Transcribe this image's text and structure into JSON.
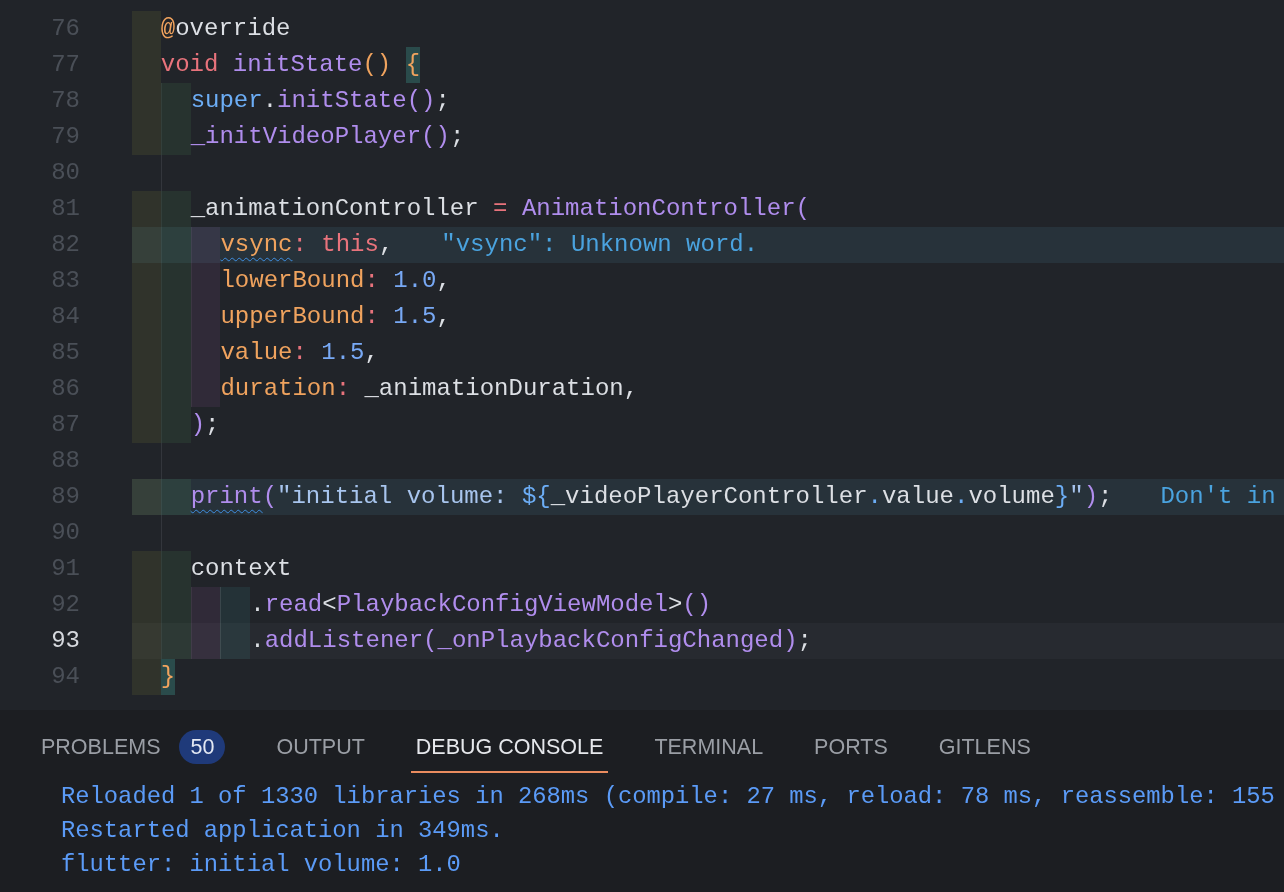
{
  "editor": {
    "lines": [
      {
        "number": "76",
        "current": false,
        "tokens": [
          {
            "text": "  @",
            "kind": "annotation"
          },
          {
            "text": "override",
            "kind": "plain"
          }
        ]
      },
      {
        "number": "77",
        "current": false,
        "tokens": [
          {
            "text": "  void ",
            "kind": "keyword"
          },
          {
            "text": "initState",
            "kind": "function"
          },
          {
            "text": "() ",
            "kind": "bracket"
          },
          {
            "text": "{",
            "kind": "matched-bracket"
          }
        ]
      },
      {
        "number": "78",
        "current": false,
        "tokens": [
          {
            "text": "    super",
            "kind": "builtin"
          },
          {
            "text": ".",
            "kind": "plain"
          },
          {
            "text": "initState",
            "kind": "function"
          },
          {
            "text": "()",
            "kind": "paren"
          },
          {
            "text": ";",
            "kind": "plain"
          }
        ]
      },
      {
        "number": "79",
        "current": false,
        "tokens": [
          {
            "text": "    _initVideoPlayer",
            "kind": "function"
          },
          {
            "text": "()",
            "kind": "paren"
          },
          {
            "text": ";",
            "kind": "plain"
          }
        ]
      },
      {
        "number": "80",
        "current": false
      },
      {
        "number": "81",
        "current": false,
        "tokens": [
          {
            "text": "    _animationController ",
            "kind": "plain"
          },
          {
            "text": "= ",
            "kind": "operator"
          },
          {
            "text": "AnimationController",
            "kind": "function"
          },
          {
            "text": "(",
            "kind": "paren"
          }
        ]
      },
      {
        "number": "82",
        "current": false,
        "diagnostic": "\"vsync\": Unknown word.",
        "tokens": [
          {
            "text": "      vsync",
            "kind": "property"
          },
          {
            "text": ": ",
            "kind": "operator"
          },
          {
            "text": "this",
            "kind": "keyword"
          },
          {
            "text": ",",
            "kind": "plain"
          }
        ]
      },
      {
        "number": "83",
        "current": false,
        "tokens": [
          {
            "text": "      lowerBound",
            "kind": "property"
          },
          {
            "text": ": ",
            "kind": "operator"
          },
          {
            "text": "1.0",
            "kind": "number"
          },
          {
            "text": ",",
            "kind": "plain"
          }
        ]
      },
      {
        "number": "84",
        "current": false,
        "tokens": [
          {
            "text": "      upperBound",
            "kind": "property"
          },
          {
            "text": ": ",
            "kind": "operator"
          },
          {
            "text": "1.5",
            "kind": "number"
          },
          {
            "text": ",",
            "kind": "plain"
          }
        ]
      },
      {
        "number": "85",
        "current": false,
        "tokens": [
          {
            "text": "      value",
            "kind": "property"
          },
          {
            "text": ": ",
            "kind": "operator"
          },
          {
            "text": "1.5",
            "kind": "number"
          },
          {
            "text": ",",
            "kind": "plain"
          }
        ]
      },
      {
        "number": "86",
        "current": false,
        "tokens": [
          {
            "text": "      duration",
            "kind": "property"
          },
          {
            "text": ": ",
            "kind": "operator"
          },
          {
            "text": "_animationDuration,",
            "kind": "plain"
          }
        ]
      },
      {
        "number": "87",
        "current": false,
        "tokens": [
          {
            "text": "    )",
            "kind": "paren"
          },
          {
            "text": ";",
            "kind": "plain"
          }
        ]
      },
      {
        "number": "88",
        "current": false
      },
      {
        "number": "89",
        "current": false,
        "diagnostic": "Don't in",
        "tokens": [
          {
            "text": "    print",
            "kind": "function"
          },
          {
            "text": "(",
            "kind": "paren"
          },
          {
            "text": "\"initial volume: ",
            "kind": "string"
          },
          {
            "text": "${",
            "kind": "interpolation"
          },
          {
            "text": "_videoPlayerController",
            "kind": "plain"
          },
          {
            "text": ".",
            "kind": "interpolation"
          },
          {
            "text": "value",
            "kind": "plain"
          },
          {
            "text": ".",
            "kind": "interpolation"
          },
          {
            "text": "volume",
            "kind": "plain"
          },
          {
            "text": "}",
            "kind": "interpolation"
          },
          {
            "text": "\"",
            "kind": "string"
          },
          {
            "text": ")",
            "kind": "paren"
          },
          {
            "text": ";",
            "kind": "plain"
          }
        ]
      },
      {
        "number": "90",
        "current": false
      },
      {
        "number": "91",
        "current": false,
        "tokens": [
          {
            "text": "    context",
            "kind": "plain"
          }
        ]
      },
      {
        "number": "92",
        "current": false,
        "tokens": [
          {
            "text": "        .",
            "kind": "plain"
          },
          {
            "text": "read",
            "kind": "function"
          },
          {
            "text": "<",
            "kind": "plain"
          },
          {
            "text": "PlaybackConfigViewModel",
            "kind": "function"
          },
          {
            "text": ">",
            "kind": "plain"
          },
          {
            "text": "()",
            "kind": "paren"
          }
        ]
      },
      {
        "number": "93",
        "current": true,
        "tokens": [
          {
            "text": "        .",
            "kind": "plain"
          },
          {
            "text": "addListener",
            "kind": "function"
          },
          {
            "text": "(",
            "kind": "paren"
          },
          {
            "text": "_onPlaybackConfigChanged",
            "kind": "function"
          },
          {
            "text": ")",
            "kind": "paren"
          },
          {
            "text": ";",
            "kind": "plain"
          }
        ]
      },
      {
        "number": "94",
        "current": false,
        "tokens": [
          {
            "text": "  }",
            "kind": "matched-bracket"
          }
        ]
      }
    ]
  },
  "panel": {
    "tabs": [
      {
        "label": "PROBLEMS",
        "selected": false,
        "badge": "50"
      },
      {
        "label": "OUTPUT",
        "selected": false
      },
      {
        "label": "DEBUG CONSOLE",
        "selected": true
      },
      {
        "label": "TERMINAL",
        "selected": false
      },
      {
        "label": "PORTS",
        "selected": false
      },
      {
        "label": "GITLENS",
        "selected": false
      }
    ],
    "console": [
      "Reloaded 1 of 1330 libraries in 268ms (compile: 27 ms, reload: 78 ms, reassemble: 155",
      "Restarted application in 349ms.",
      "flutter: initial volume: 1.0"
    ]
  }
}
